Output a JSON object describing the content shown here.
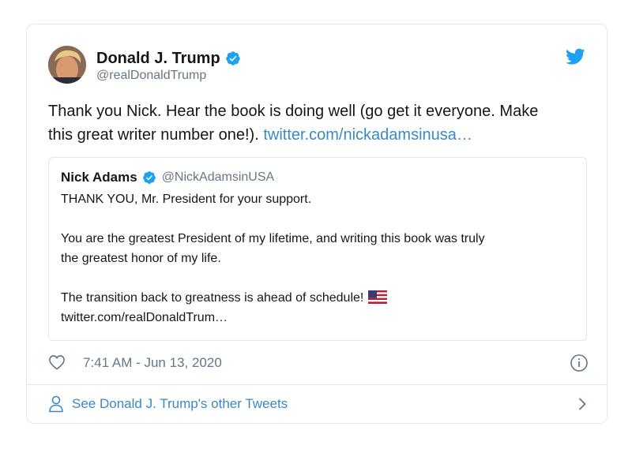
{
  "tweet": {
    "author": {
      "name": "Donald J. Trump",
      "handle": "@realDonaldTrump"
    },
    "text_line1": "Thank you Nick. Hear the book is doing well (go get it everyone. Make",
    "text_line2": "this great writer number one!).",
    "link": "twitter.com/nickadamsinusa…",
    "timestamp": "7:41 AM - Jun 13, 2020",
    "footer_link": "See Donald J. Trump's other Tweets"
  },
  "quote": {
    "author": {
      "name": "Nick Adams",
      "handle": "@NickAdamsinUSA"
    },
    "line1": "THANK YOU, Mr. President for your support.",
    "line2": "You are the greatest President of my lifetime, and writing this book was truly",
    "line3": "the greatest honor of my life.",
    "line4": "The transition back to greatness is ahead of schedule!",
    "line5": "twitter.com/realDonaldTrum…"
  },
  "icons": {
    "verified": "verified-badge-icon",
    "twitter": "twitter-bird-icon",
    "heart": "heart-icon",
    "info": "info-icon",
    "person": "person-icon",
    "chevron": "chevron-right-icon",
    "flag": "us-flag-icon"
  },
  "colors": {
    "link": "#3b88c3",
    "verified": "#1da1f2",
    "secondary_text": "#657786",
    "border": "#e1e8ed"
  }
}
